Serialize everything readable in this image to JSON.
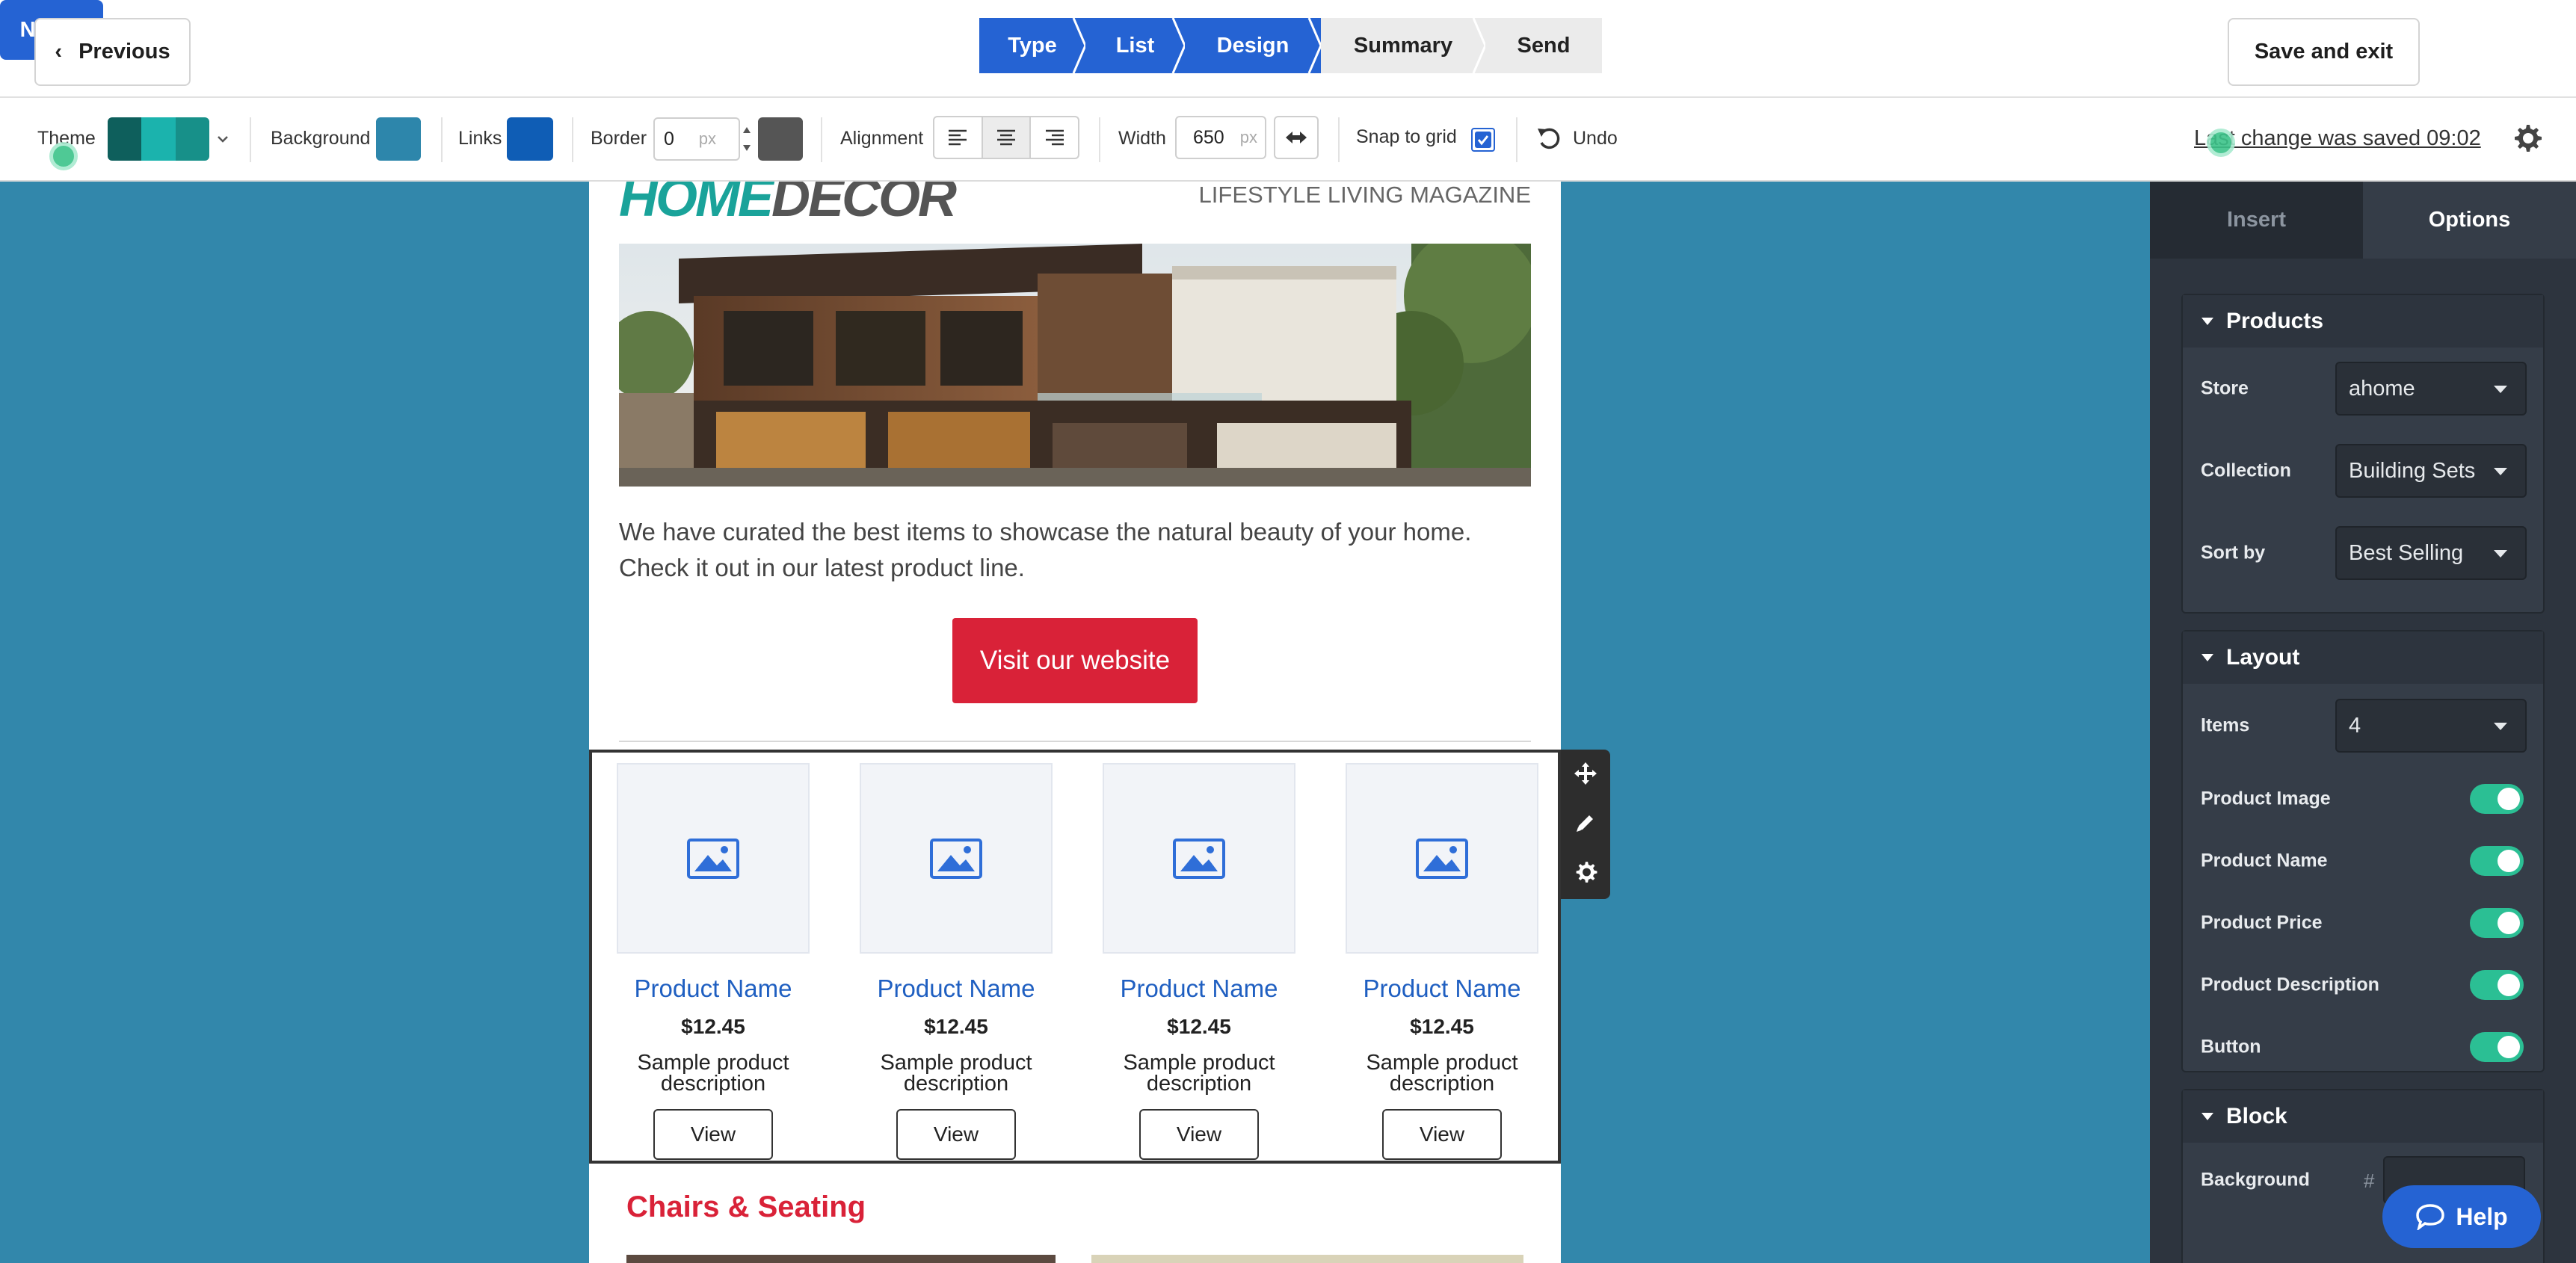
{
  "header": {
    "previous_label": "Previous",
    "steps": [
      {
        "label": "Type",
        "state": "active"
      },
      {
        "label": "List",
        "state": "active"
      },
      {
        "label": "Design",
        "state": "active"
      },
      {
        "label": "Summary",
        "state": "inactive"
      },
      {
        "label": "Send",
        "state": "inactive"
      }
    ],
    "save_exit_label": "Save and exit",
    "next_label": "Next"
  },
  "toolbar": {
    "theme_label": "Theme",
    "theme_colors": [
      "#0e5f5c",
      "#1bb3ad",
      "#179089"
    ],
    "background_label": "Background",
    "background_color": "#2d86ab",
    "links_label": "Links",
    "links_color": "#0f5db5",
    "border_label": "Border",
    "border_value": "0",
    "border_unit": "px",
    "border_color": "#555555",
    "alignment_label": "Alignment",
    "alignment_selected": "center",
    "width_label": "Width",
    "width_value": "650",
    "width_unit": "px",
    "snap_label": "Snap to grid",
    "snap_checked": true,
    "undo_label": "Undo",
    "last_saved": "Last change was saved 09:02"
  },
  "email": {
    "logo_home": "HOME",
    "logo_decor": "DECOR",
    "tagline": "LIFESTYLE LIVING MAGAZINE",
    "intro_text": "We have curated the best items to showcase the natural beauty of your home. Check it out in our latest product line.",
    "cta_label": "Visit our website",
    "products": [
      {
        "name": "Product Name",
        "price": "$12.45",
        "description": "Sample product description",
        "button": "View"
      },
      {
        "name": "Product Name",
        "price": "$12.45",
        "description": "Sample product description",
        "button": "View"
      },
      {
        "name": "Product Name",
        "price": "$12.45",
        "description": "Sample product description",
        "button": "View"
      },
      {
        "name": "Product Name",
        "price": "$12.45",
        "description": "Sample product description",
        "button": "View"
      }
    ],
    "section_heading": "Chairs & Seating"
  },
  "panel": {
    "tabs": [
      {
        "label": "Insert",
        "active": false
      },
      {
        "label": "Options",
        "active": true
      }
    ],
    "products_section": {
      "title": "Products",
      "store_label": "Store",
      "store_value": "ahome",
      "collection_label": "Collection",
      "collection_value": "Building Sets",
      "sort_label": "Sort by",
      "sort_value": "Best Selling"
    },
    "layout_section": {
      "title": "Layout",
      "items_label": "Items",
      "items_value": "4",
      "toggles": [
        {
          "label": "Product Image",
          "on": true
        },
        {
          "label": "Product Name",
          "on": true
        },
        {
          "label": "Product Price",
          "on": true
        },
        {
          "label": "Product Description",
          "on": true
        },
        {
          "label": "Button",
          "on": true
        }
      ]
    },
    "block_section": {
      "title": "Block",
      "background_label": "Background",
      "background_hash": "#"
    }
  },
  "help_label": "Help"
}
